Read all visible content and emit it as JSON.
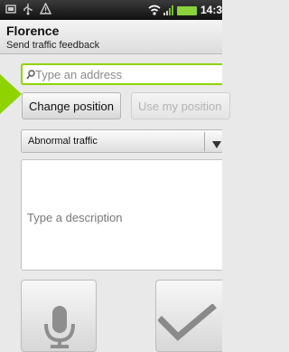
{
  "status_bar": {
    "left_icons": [
      "notification-icon",
      "usb-icon",
      "warning-icon"
    ],
    "right_icons": [
      "wifi-icon",
      "signal-icon",
      "battery-icon"
    ],
    "time": "14:3"
  },
  "header": {
    "title": "Florence",
    "subtitle": "Send traffic feedback"
  },
  "address": {
    "placeholder": "Type an address",
    "value": ""
  },
  "position_buttons": {
    "change_label": "Change position",
    "use_label": "Use my position"
  },
  "traffic_type": {
    "selected": "Abnormal traffic"
  },
  "description": {
    "placeholder": "Type a description",
    "value": ""
  },
  "actions": {
    "mic_icon": "microphone-icon",
    "confirm_icon": "checkmark-icon"
  },
  "colors": {
    "accent": "#8fd400",
    "battery": "#8bd23c"
  }
}
